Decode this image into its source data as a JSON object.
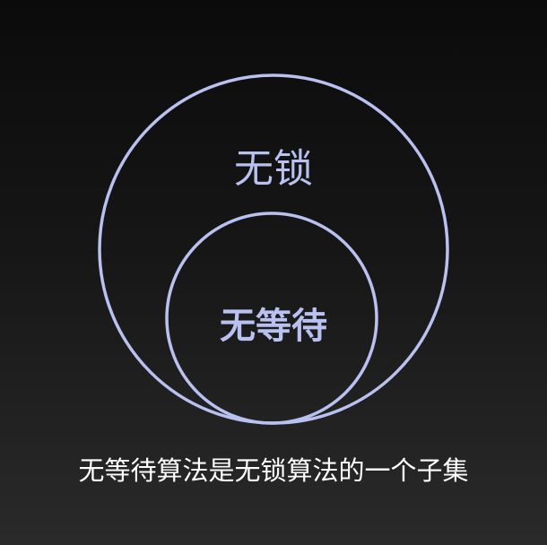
{
  "diagram": {
    "outer_set_label": "无锁",
    "inner_set_label": "无等待",
    "caption": "无等待算法是无锁算法的一个子集",
    "stroke_color": "#b8c1ef",
    "caption_color": "#ffffff",
    "background_top": "#0b0b0b",
    "background_bottom": "#2a2a2a"
  }
}
